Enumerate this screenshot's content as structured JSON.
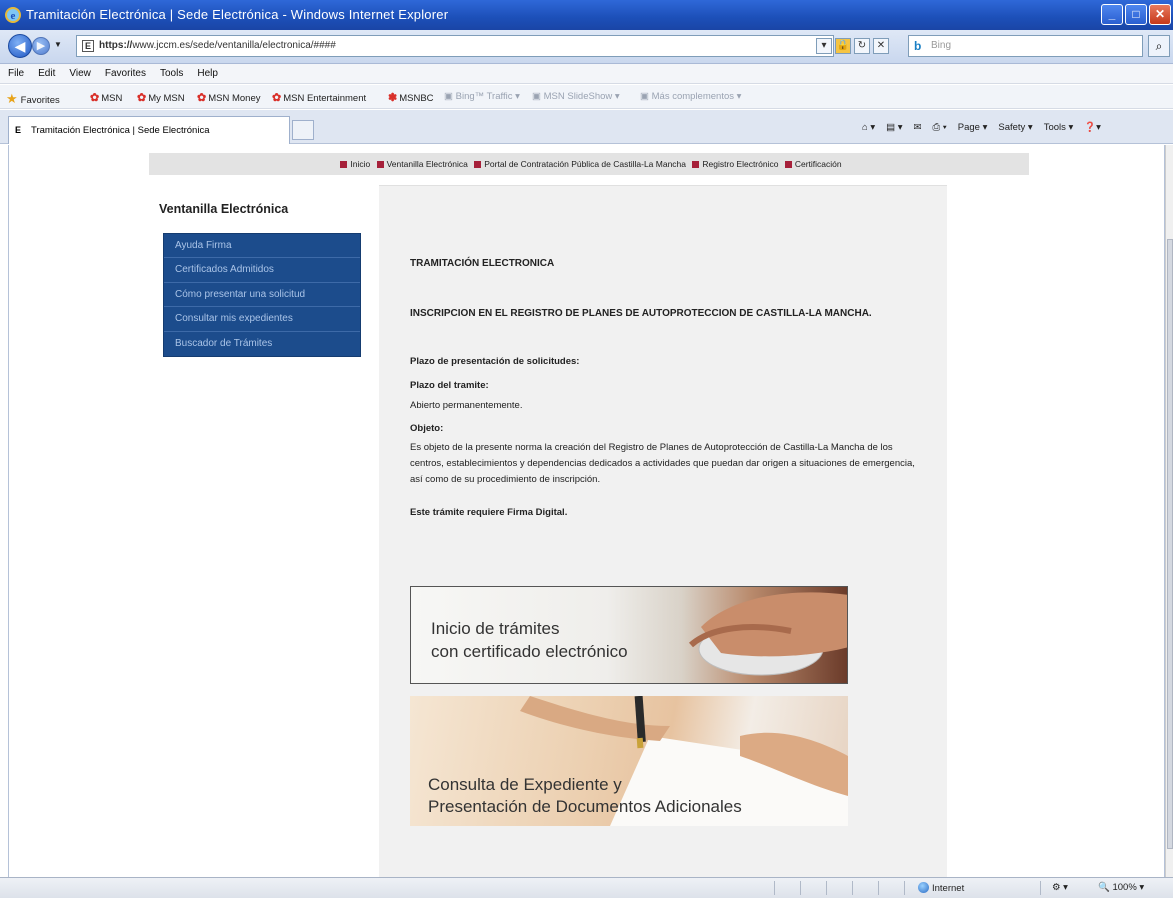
{
  "window": {
    "title": "Tramitación Electrónica | Sede Electrónica - Windows Internet Explorer"
  },
  "address_bar": {
    "url_prefix": "https://",
    "url_host": "www.jccm.es",
    "url_path": "/sede/ventanilla/electronica/####",
    "search_placeholder": "Bing"
  },
  "menu": [
    "File",
    "Edit",
    "View",
    "Favorites",
    "Tools",
    "Help"
  ],
  "favorites_bar": {
    "label": "Favorites",
    "items": [
      "MSN",
      "My MSN",
      "MSN Money",
      "MSN Entertainment",
      "MSNBC",
      "Bing™ Traffic ▾",
      "MSN SlideShow ▾",
      "Más complementos ▾"
    ]
  },
  "tab": {
    "title": "Tramitación Electrónica | Sede Electrónica"
  },
  "command_bar": [
    "Page ▾",
    "Safety ▾",
    "Tools ▾"
  ],
  "page": {
    "top_nav": [
      "Inicio",
      "Ventanilla Electrónica",
      "Portal de Contratación Pública de Castilla-La Mancha",
      "Registro Electrónico",
      "Certificación"
    ],
    "sidebar": {
      "title": "Ventanilla Electrónica",
      "items": [
        "Ayuda Firma",
        "Certificados Admitidos",
        "Cómo presentar una solicitud",
        "Consultar mis expedientes",
        "Buscador de Trámites"
      ]
    },
    "content": {
      "heading": "TRAMITACIÓN ELECTRONICA",
      "subheading": "INSCRIPCION EN EL REGISTRO DE PLANES DE AUTOPROTECCION DE CASTILLA-LA MANCHA.",
      "plazo_solicitudes_label": "Plazo de presentación de solicitudes:",
      "plazo_tramite_label": "Plazo del tramite:",
      "plazo_tramite_value": "Abierto permanentemente.",
      "objeto_label": "Objeto:",
      "objeto_text": "Es objeto de la presente norma la creación del Registro de Planes de Autoprotección de Castilla-La Mancha de los centros, establecimientos y dependencias dedicados a actividades que puedan dar origen a situaciones de emergencia, así como de su procedimiento de inscripción.",
      "firma_note": "Este trámite requiere Firma Digital.",
      "banner1": {
        "line1": "Inicio de trámites",
        "line2": "con certificado electrónico"
      },
      "banner2": {
        "line1": "Consulta de Expediente y",
        "line2": "Presentación de Documentos Adicionales"
      }
    }
  },
  "status_bar": {
    "zone": "Internet",
    "zoom": "100%"
  }
}
